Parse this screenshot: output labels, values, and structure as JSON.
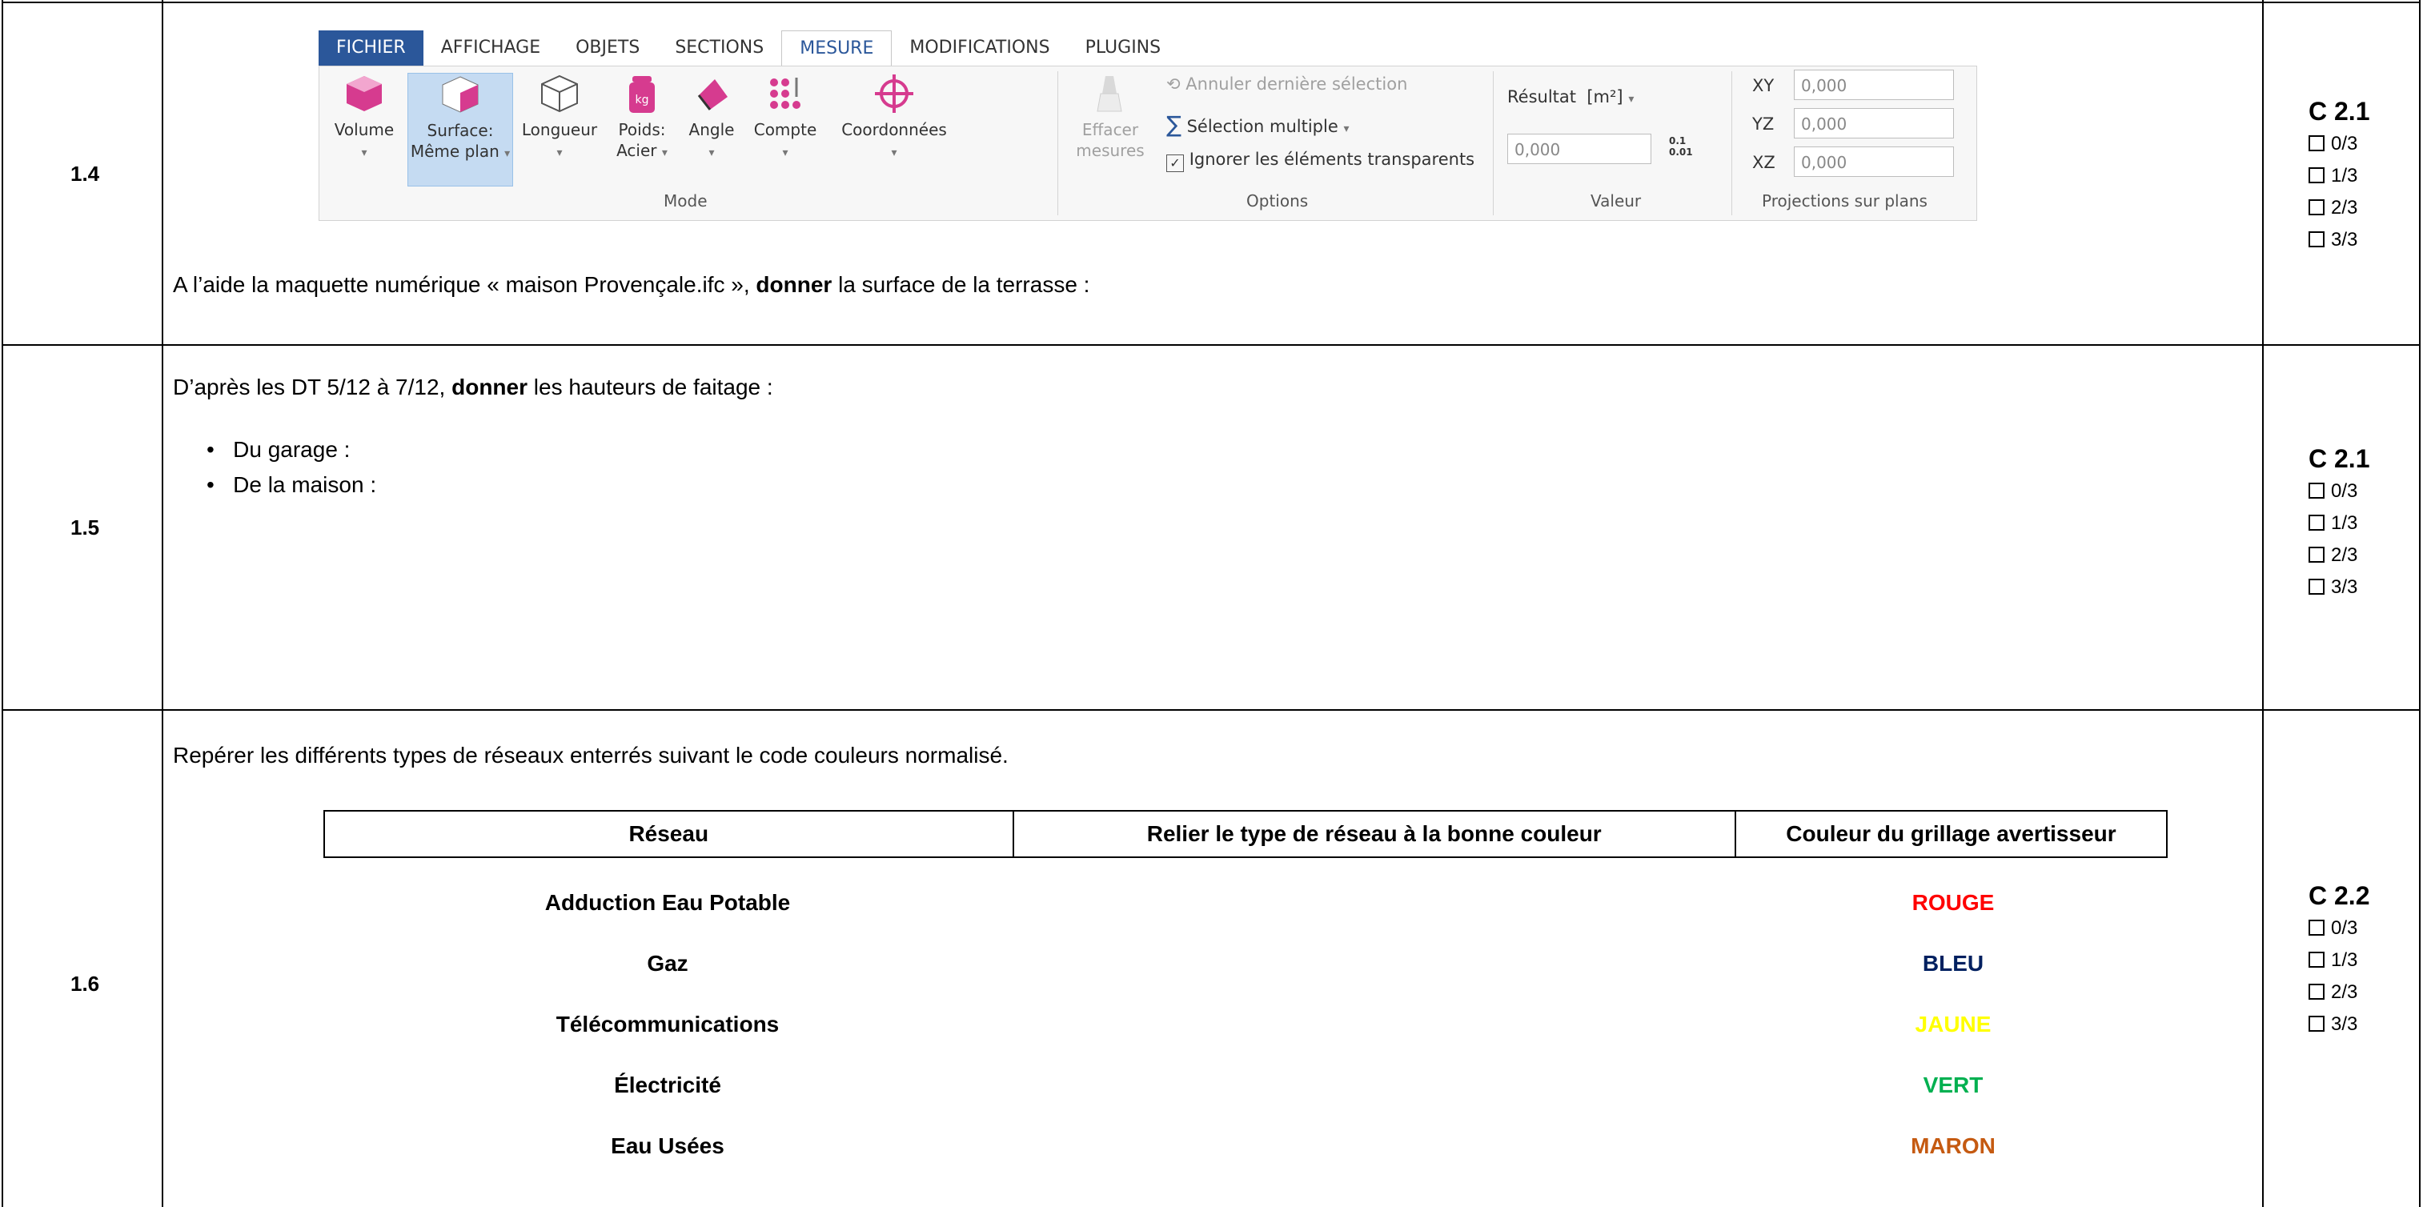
{
  "rows": [
    {
      "id": "1.4",
      "criterion": "C 2.1"
    },
    {
      "id": "1.5",
      "criterion": "C 2.1"
    },
    {
      "id": "1.6",
      "criterion": "C 2.2"
    }
  ],
  "score_options": [
    "0/3",
    "1/3",
    "2/3",
    "3/3"
  ],
  "ribbon": {
    "tabs": [
      "FICHIER",
      "AFFICHAGE",
      "OBJETS",
      "SECTIONS",
      "MESURE",
      "MODIFICATIONS",
      "PLUGINS"
    ],
    "buttons": {
      "volume": "Volume",
      "surface_1": "Surface:",
      "surface_2": "Même plan",
      "longueur": "Longueur",
      "poids_1": "Poids:",
      "poids_2": "Acier",
      "angle": "Angle",
      "compte": "Compte",
      "coordonnees": "Coordonnées",
      "effacer_1": "Effacer",
      "effacer_2": "mesures"
    },
    "groups": {
      "mode": "Mode",
      "options": "Options",
      "valeur": "Valeur",
      "projections": "Projections sur plans"
    },
    "options": {
      "annuler": "Annuler dernière sélection",
      "selection_multiple": "Sélection multiple",
      "ignorer": "Ignorer les éléments transparents"
    },
    "valeur": {
      "resultat_label": "Résultat",
      "unit": "[m²]",
      "value": "0,000",
      "precision_top": "0.1",
      "precision_bottom": "0.01"
    },
    "projections": [
      {
        "label": "XY",
        "value": "0,000"
      },
      {
        "label": "YZ",
        "value": "0,000"
      },
      {
        "label": "XZ",
        "value": "0,000"
      }
    ]
  },
  "q14": {
    "pre": "A l’aide la maquette numérique « maison Provençale.ifc », ",
    "bold": "donner",
    "post": " la surface de la terrasse :"
  },
  "q15": {
    "pre": "D’après les DT 5/12 à 7/12, ",
    "bold": "donner",
    "post": " les hauteurs de faitage :",
    "bullets": [
      "Du garage :",
      "De la maison :"
    ]
  },
  "q16": {
    "intro": "Repérer les différents types de réseaux enterrés suivant le code couleurs normalisé.",
    "headers": [
      "Réseau",
      "Relier le type de réseau à la bonne couleur",
      "Couleur du grillage avertisseur"
    ],
    "networks": [
      "Adduction Eau Potable",
      "Gaz",
      "Télécommunications",
      "Électricité",
      "Eau Usées"
    ],
    "colors": [
      {
        "label": "ROUGE",
        "hex": "#ff0000"
      },
      {
        "label": "BLEU",
        "hex": "#002060"
      },
      {
        "label": "JAUNE",
        "hex": "#ffff00"
      },
      {
        "label": "VERT",
        "hex": "#00b050"
      },
      {
        "label": "MARON",
        "hex": "#c55a11"
      }
    ]
  }
}
